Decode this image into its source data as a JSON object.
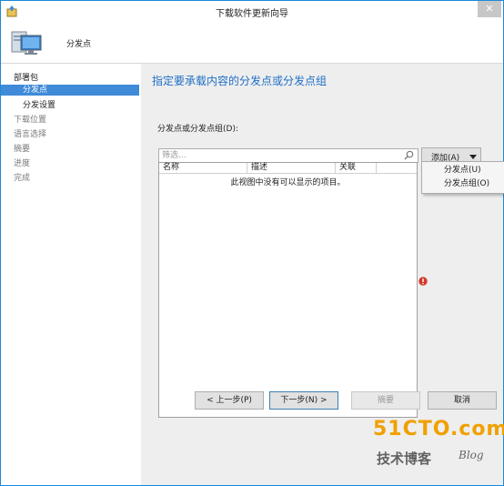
{
  "window": {
    "title": "下载软件更新向导",
    "close_glyph": "✕"
  },
  "header": {
    "title": "分发点"
  },
  "sidebar": {
    "items": [
      {
        "label": "部署包"
      },
      {
        "label": "分发点"
      },
      {
        "label": "分发设置"
      },
      {
        "label": "下载位置"
      },
      {
        "label": "语言选择"
      },
      {
        "label": "摘要"
      },
      {
        "label": "进度"
      },
      {
        "label": "完成"
      }
    ]
  },
  "main": {
    "title": "指定要承载内容的分发点或分发点组",
    "field_label": "分发点或分发点组(D):",
    "filter": {
      "placeholder": "筛选...",
      "value": ""
    },
    "add_button": {
      "label": "添加(A)"
    },
    "columns": [
      "名称",
      "描述",
      "关联"
    ],
    "empty_message": "此视图中没有可以显示的项目。"
  },
  "dropdown": {
    "items": [
      "分发点(U)",
      "分发点组(O)"
    ]
  },
  "buttons": {
    "prev": "< 上一步(P)",
    "next": "下一步(N) >",
    "summary": "摘要",
    "cancel": "取消"
  },
  "watermark": {
    "main": "51CTO.com",
    "sub": "技术博客",
    "blog": "Blog"
  },
  "colors": {
    "accent": "#3f8bd8",
    "title_blue": "#1e6fc6",
    "error": "#d23a2a",
    "watermark": "#f0a000"
  }
}
